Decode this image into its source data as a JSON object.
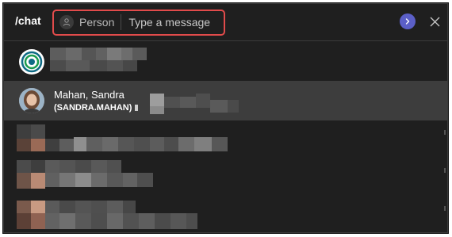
{
  "topbar": {
    "command": "/chat",
    "person_label": "Person",
    "message_placeholder": "Type a message"
  },
  "icons": {
    "person": "person-icon",
    "send": "chevron-right-icon",
    "close": "close-icon"
  },
  "results": [
    {
      "name": "",
      "detail": ""
    },
    {
      "name": "Mahan, Sandra",
      "detail": "(SANDRA.MAHAN)"
    },
    {
      "name": "",
      "detail": ""
    },
    {
      "name": "",
      "detail": ""
    },
    {
      "name": "",
      "detail": ""
    }
  ],
  "colors": {
    "accent": "#5b5fc7",
    "highlight_border": "#e14b4b",
    "background": "#1f1f1f",
    "selected_row": "#3d3d3d"
  }
}
